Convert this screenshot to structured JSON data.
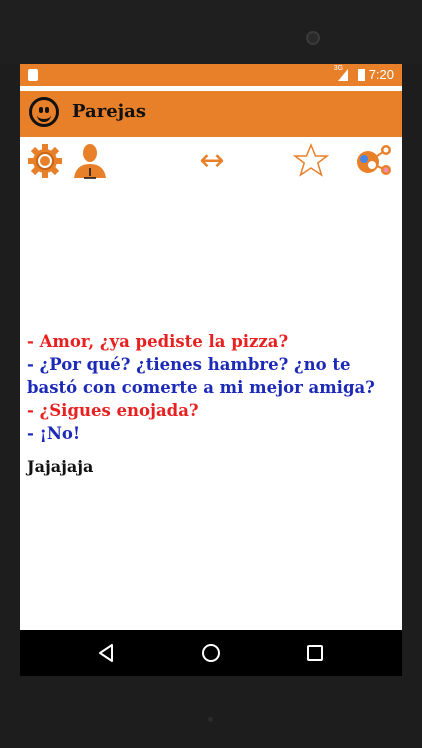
{
  "status_bar": {
    "time": "7:20",
    "network_label": "3G"
  },
  "app": {
    "title": "Parejas",
    "accent_color": "#e8802a"
  },
  "toolbar": {
    "icons": [
      "gear-icon",
      "person-icon",
      "swap-arrows-icon",
      "star-icon",
      "share-icon"
    ],
    "swap_glyph": "↔"
  },
  "joke": {
    "lines": [
      "- Amor, ¿ya pediste la pizza?",
      "- ¿Por qué? ¿tienes hambre? ¿no te bastó con comerte a mi mejor amiga?",
      "- ¿Sigues enojada?",
      "- ¡No!"
    ],
    "punchline": "Jajajaja"
  },
  "nav": {
    "icons": [
      "back-icon",
      "home-icon",
      "recents-icon"
    ]
  }
}
